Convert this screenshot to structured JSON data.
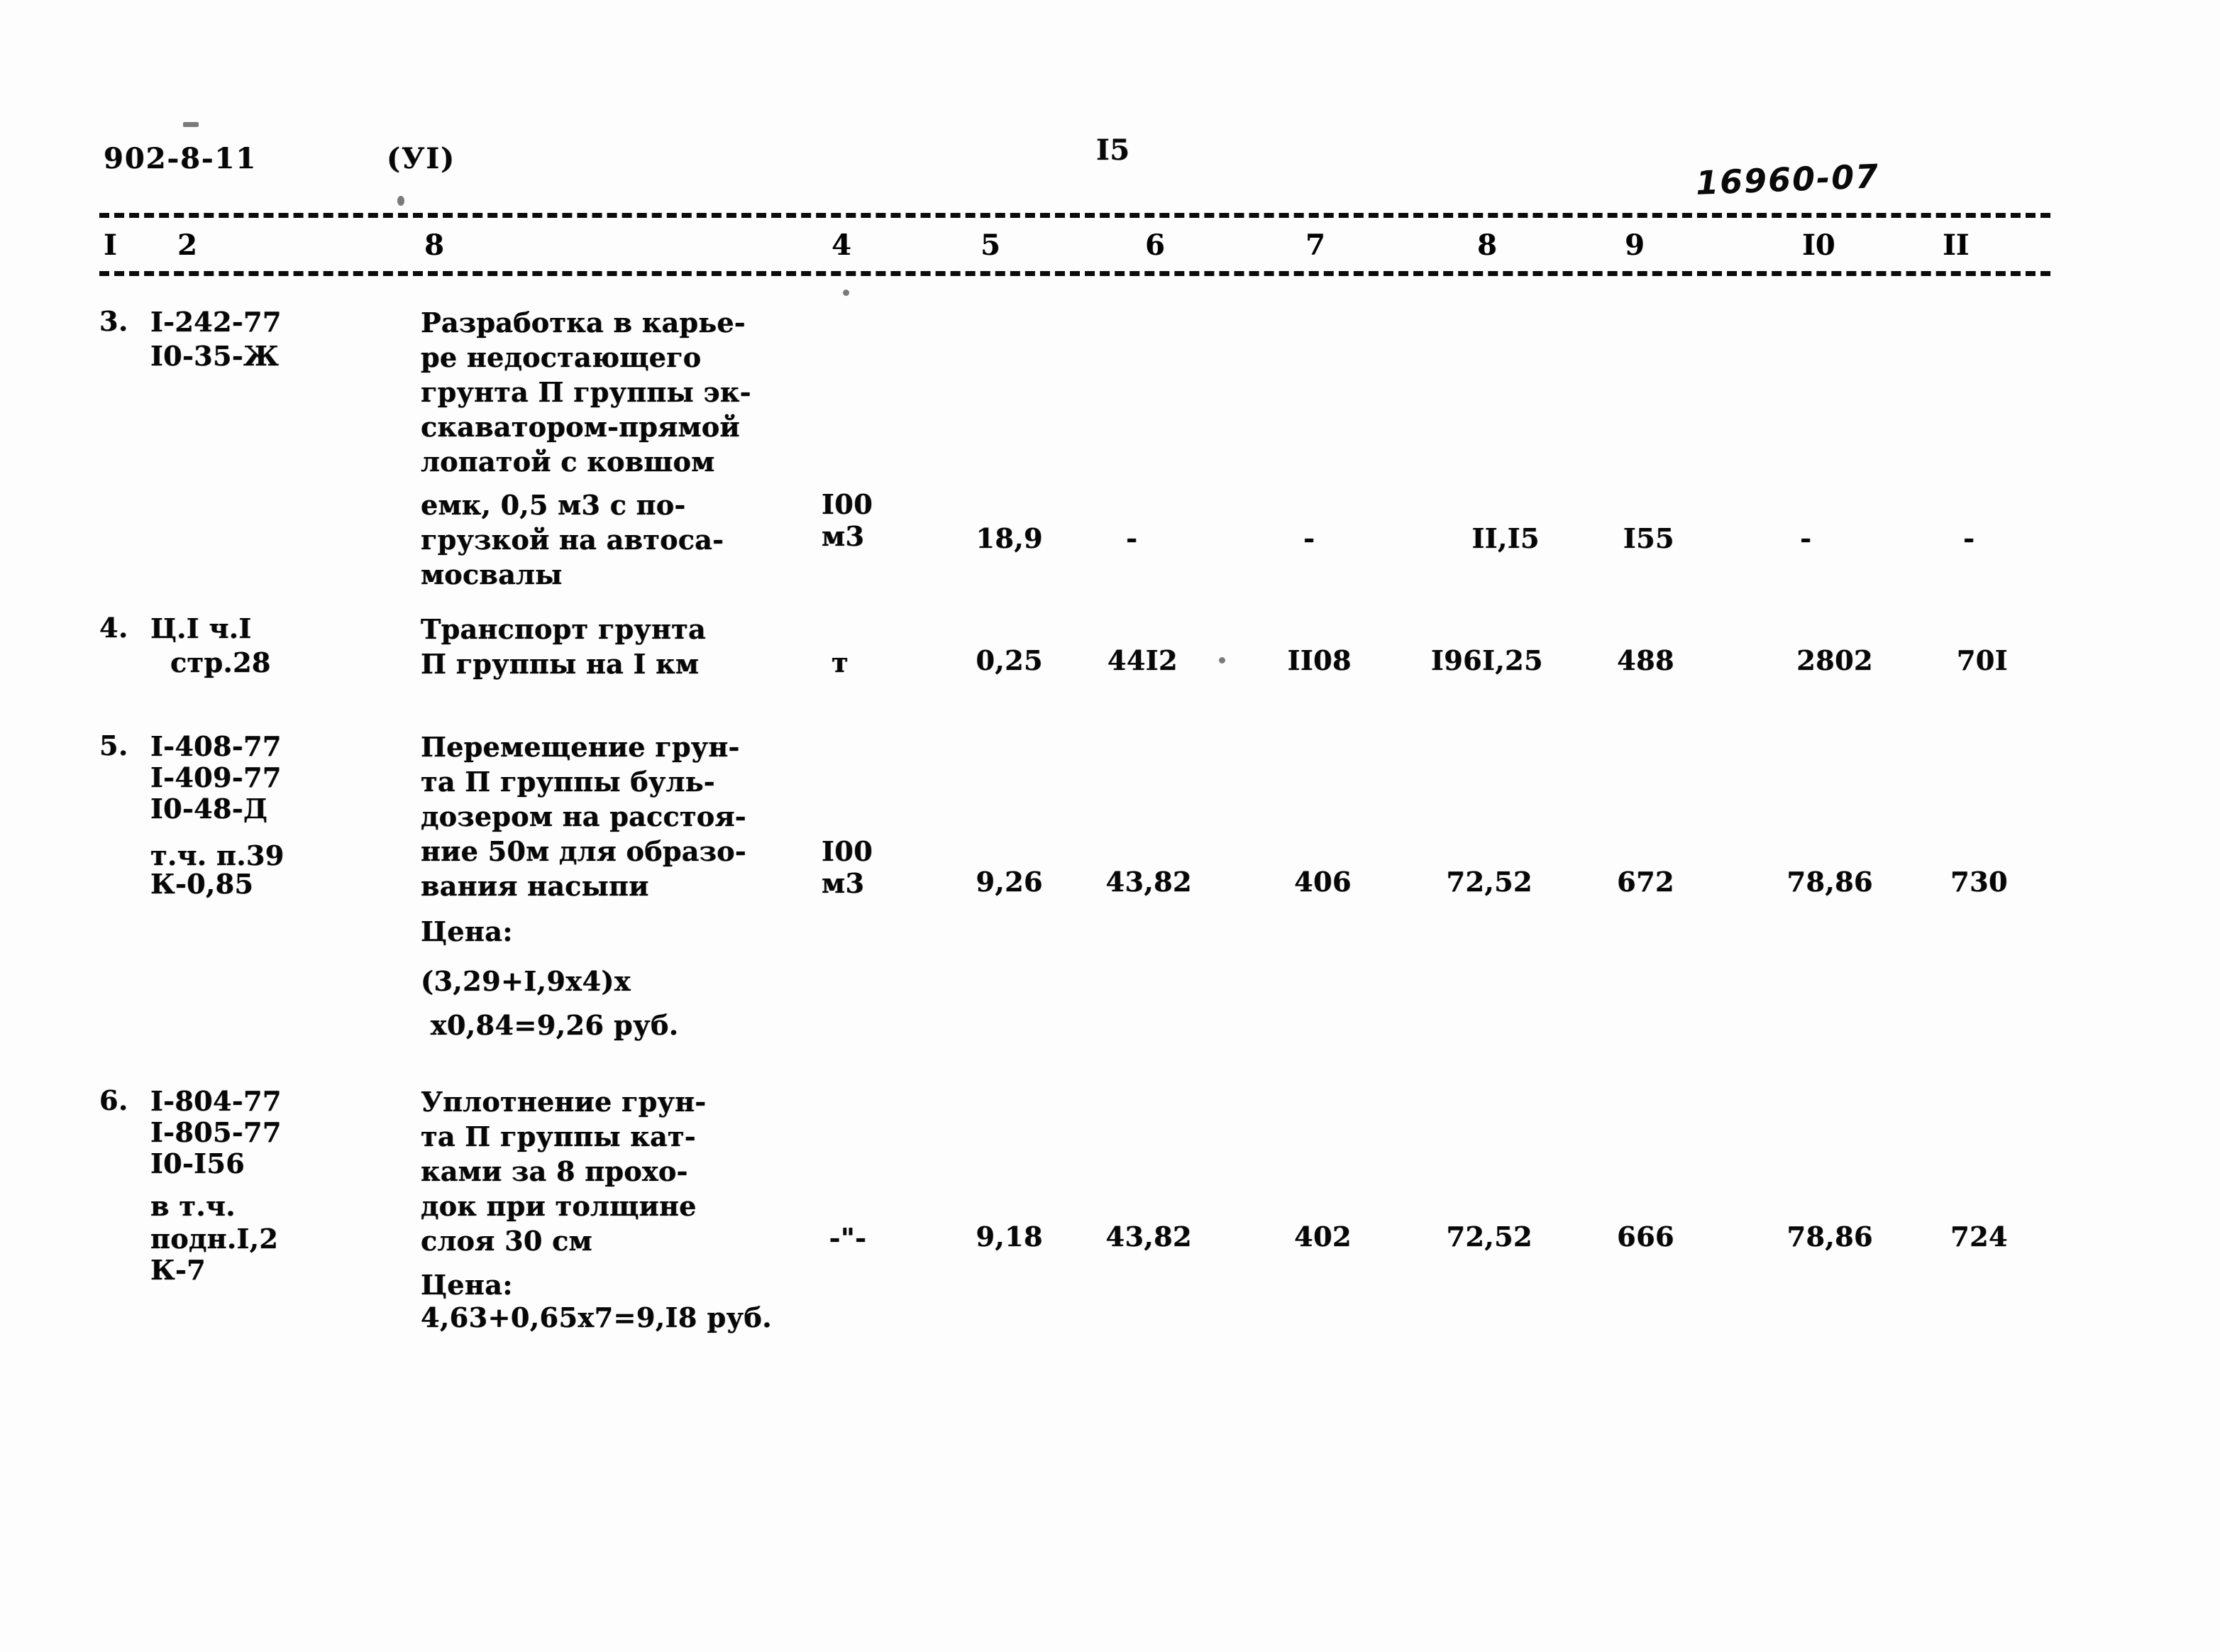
{
  "document": {
    "series_code": "902-8-11",
    "part_marker": "(УI)",
    "page_number": "I5",
    "archive_stamp": "16960-07"
  },
  "table": {
    "column_headers": [
      "I",
      "2",
      "8",
      "4",
      "5",
      "6",
      "7",
      "8",
      "9",
      "I0",
      "II"
    ],
    "rows": [
      {
        "no": "3.",
        "codes": [
          "I-242-77",
          "I0-35-Ж"
        ],
        "description": [
          "Разработка в карье-",
          "ре недостающего",
          "грунта П группы эк-",
          "скаватором-прямой",
          "лопатой с ковшом",
          "емк, 0,5 м3 с по-",
          "грузкой на автоса-",
          "мосвалы"
        ],
        "unit": [
          "I00",
          "м3"
        ],
        "c5": "18,9",
        "c6": "-",
        "c7": "-",
        "c8": "II,I5",
        "c9": "I55",
        "c10": "-",
        "c11": "-",
        "note": []
      },
      {
        "no": "4.",
        "codes": [
          "Ц.I ч.I",
          "стр.28"
        ],
        "description": [
          "Транспорт грунта",
          "П группы на I км"
        ],
        "unit": [
          "т"
        ],
        "c5": "0,25",
        "c6": "44I2",
        "c7": "II08",
        "c8": "I96I,25",
        "c9": "488",
        "c10": "2802",
        "c11": "70I",
        "note": []
      },
      {
        "no": "5.",
        "codes": [
          "I-408-77",
          "I-409-77",
          "I0-48-Д",
          "т.ч. п.39",
          "К-0,85"
        ],
        "description": [
          "Перемещение грун-",
          "та П группы буль-",
          "дозером на расстоя-",
          "ние 50м для образо-",
          "вания насыпи"
        ],
        "unit": [
          "I00",
          "м3"
        ],
        "c5": "9,26",
        "c6": "43,82",
        "c7": "406",
        "c8": "72,52",
        "c9": "672",
        "c10": "78,86",
        "c11": "730",
        "note": [
          "Цена:",
          "(3,29+I,9х4)х",
          " х0,84=9,26 руб."
        ]
      },
      {
        "no": "6.",
        "codes": [
          "I-804-77",
          "I-805-77",
          "I0-I56",
          "в т.ч.",
          "подн.I,2",
          "К-7"
        ],
        "description": [
          "Уплотнение грун-",
          "та П группы кат-",
          "ками за 8 прохо-",
          "док при толщине",
          "слоя 30 см"
        ],
        "unit": [
          "-\"-"
        ],
        "c5": "9,18",
        "c6": "43,82",
        "c7": "402",
        "c8": "72,52",
        "c9": "666",
        "c10": "78,86",
        "c11": "724",
        "note": [
          "Цена:",
          "4,63+0,65х7=9,I8 руб."
        ]
      }
    ]
  }
}
